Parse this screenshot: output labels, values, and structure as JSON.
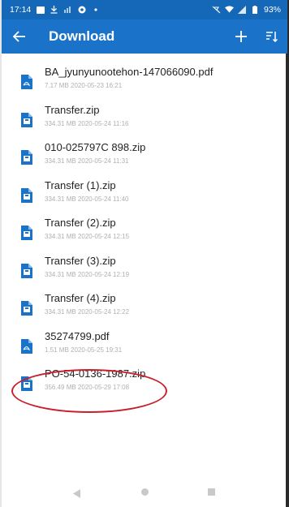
{
  "status_bar": {
    "time": "17:14",
    "battery": "93%",
    "left_icons": [
      "message-icon",
      "download-icon",
      "signal-alt-icon",
      "app-icon",
      "dot-icon"
    ],
    "right_icons": [
      "mute-icon",
      "wifi-icon",
      "signal-icon",
      "battery-icon"
    ]
  },
  "app_bar": {
    "title": "Download",
    "back_icon": "arrow-back-icon",
    "add_icon": "plus-icon",
    "sort_icon": "sort-icon"
  },
  "files": [
    {
      "name": "BA_jyunyunootehon-147066090.pdf",
      "meta": "7.17 MB 2020-05-23 16:21",
      "type": "pdf"
    },
    {
      "name": "Transfer.zip",
      "meta": "334.31 MB 2020-05-24 11:16",
      "type": "zip"
    },
    {
      "name": "010-025797C 898.zip",
      "meta": "334.31 MB 2020-05-24 11:31",
      "type": "zip"
    },
    {
      "name": "Transfer (1).zip",
      "meta": "334.31 MB 2020-05-24 11:40",
      "type": "zip"
    },
    {
      "name": "Transfer (2).zip",
      "meta": "334.31 MB 2020-05-24 12:15",
      "type": "zip"
    },
    {
      "name": "Transfer (3).zip",
      "meta": "334.31 MB 2020-05-24 12:19",
      "type": "zip"
    },
    {
      "name": "Transfer (4).zip",
      "meta": "334.31 MB 2020-05-24 12:22",
      "type": "zip"
    },
    {
      "name": "35274799.pdf",
      "meta": "1.51 MB 2020-05-25 19:31",
      "type": "pdf"
    },
    {
      "name": "PO-54-0136-1987.zip",
      "meta": "356.49 MB 2020-05-29 17:08",
      "type": "zip"
    }
  ],
  "highlight": {
    "target": "PO-54-0136-1987.zip",
    "color": "#c8202a"
  },
  "nav_bar": {
    "icons": [
      "nav-back-icon",
      "nav-home-icon",
      "nav-recents-icon"
    ]
  },
  "colors": {
    "status_bar": "#1567b7",
    "app_bar": "#1a73c9",
    "pdf_icon": "#1a73c9",
    "zip_icon": "#1a73c9",
    "meta_text": "#b0b0b0"
  }
}
